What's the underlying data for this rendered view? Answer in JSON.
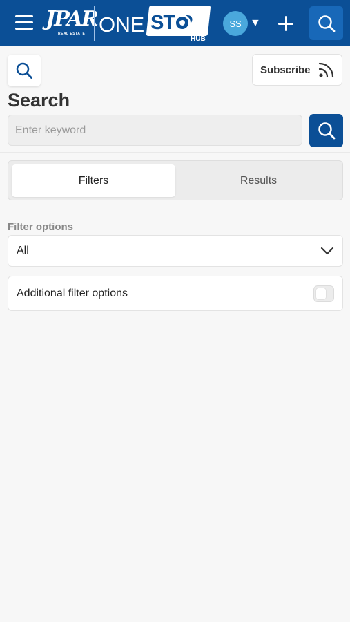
{
  "header": {
    "logo": {
      "brand": "JPAR",
      "brand_sub": "REAL ESTATE",
      "one": "ONE",
      "stop": "ST  P",
      "hub": "HUB"
    },
    "avatar_initials": "SS",
    "avatar_color": "#4aa8dc",
    "bar_color": "#0b4f96"
  },
  "toolbar": {
    "subscribe_label": "Subscribe"
  },
  "page": {
    "title": "Search"
  },
  "search": {
    "placeholder": "Enter keyword",
    "value": ""
  },
  "tabs": [
    {
      "label": "Filters",
      "active": true
    },
    {
      "label": "Results",
      "active": false
    }
  ],
  "filters": {
    "options_label": "Filter options",
    "selected": "All",
    "additional_label": "Additional filter options",
    "additional_enabled": false
  }
}
